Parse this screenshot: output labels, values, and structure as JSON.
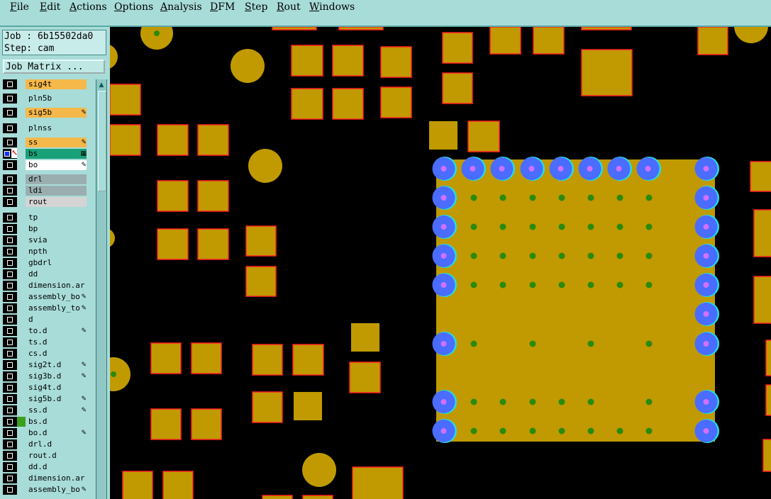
{
  "menubar": {
    "items": [
      {
        "u": "F",
        "rest": "ile"
      },
      {
        "u": "E",
        "rest": "dit"
      },
      {
        "u": "A",
        "rest": "ctions"
      },
      {
        "u": "O",
        "rest": "ptions"
      },
      {
        "u": "A",
        "rest": "nalysis"
      },
      {
        "u": "D",
        "rest": "FM"
      },
      {
        "u": "S",
        "rest": "tep"
      },
      {
        "u": "R",
        "rest": "out"
      },
      {
        "u": "W",
        "rest": "indows"
      }
    ]
  },
  "job": {
    "line1": "Job : 6b15502da0",
    "line2": "Step: cam"
  },
  "job_matrix_label": "Job Matrix ...",
  "layers": [
    {
      "name": "sig4t",
      "color": "orange",
      "mark": ""
    },
    {
      "name": "pln5b",
      "color": "cyan",
      "mark": ""
    },
    {
      "name": "sig5b",
      "color": "orange",
      "mark": "pen"
    },
    {
      "name": "plnss",
      "color": "cyan",
      "mark": ""
    },
    {
      "name": "ss",
      "color": "orange",
      "mark": "pen"
    },
    {
      "name": "bs",
      "color": "green",
      "mark": "hatch",
      "active": true
    },
    {
      "name": "bo",
      "color": "white",
      "mark": "pen"
    },
    {
      "name": "drl",
      "color": "gray",
      "mark": ""
    },
    {
      "name": "ldi",
      "color": "gray",
      "mark": ""
    },
    {
      "name": "rout",
      "color": "lgray",
      "mark": ""
    },
    {
      "name": "tp",
      "color": "cyan",
      "mark": ""
    },
    {
      "name": "bp",
      "color": "cyan",
      "mark": ""
    },
    {
      "name": "svia",
      "color": "cyan",
      "mark": ""
    },
    {
      "name": "npth",
      "color": "cyan",
      "mark": ""
    },
    {
      "name": "gbdrl",
      "color": "cyan",
      "mark": ""
    },
    {
      "name": "dd",
      "color": "cyan",
      "mark": ""
    },
    {
      "name": "dimension.ar",
      "color": "cyan",
      "mark": ""
    },
    {
      "name": "assembly_bo",
      "color": "cyan",
      "mark": "pen"
    },
    {
      "name": "assembly_to",
      "color": "cyan",
      "mark": "pen"
    },
    {
      "name": "d",
      "color": "cyan",
      "mark": ""
    },
    {
      "name": "to.d",
      "color": "cyan",
      "mark": "pen"
    },
    {
      "name": "ts.d",
      "color": "cyan",
      "mark": ""
    },
    {
      "name": "cs.d",
      "color": "cyan",
      "mark": ""
    },
    {
      "name": "sig2t.d",
      "color": "cyan",
      "mark": "pen"
    },
    {
      "name": "sig3b.d",
      "color": "cyan",
      "mark": "pen"
    },
    {
      "name": "sig4t.d",
      "color": "cyan",
      "mark": ""
    },
    {
      "name": "sig5b.d",
      "color": "cyan",
      "mark": "pen"
    },
    {
      "name": "ss.d",
      "color": "cyan",
      "mark": "pen"
    },
    {
      "name": "bs.d",
      "color": "cyan",
      "mark": "",
      "swatch": true
    },
    {
      "name": "bo.d",
      "color": "cyan",
      "mark": "pen"
    },
    {
      "name": "drl.d",
      "color": "cyan",
      "mark": ""
    },
    {
      "name": "rout.d",
      "color": "cyan",
      "mark": ""
    },
    {
      "name": "dd.d",
      "color": "cyan",
      "mark": ""
    },
    {
      "name": "dimension.ar",
      "color": "cyan",
      "mark": ""
    },
    {
      "name": "assembly_bo",
      "color": "cyan",
      "mark": "pen"
    }
  ],
  "colors": {
    "pad_fill": "#c09a00",
    "pad_outline": "#ff2020",
    "via": "#4a6cff",
    "via_center": "#d070ff",
    "via_ring": "#20e0e8",
    "dot": "#2a8a10"
  }
}
